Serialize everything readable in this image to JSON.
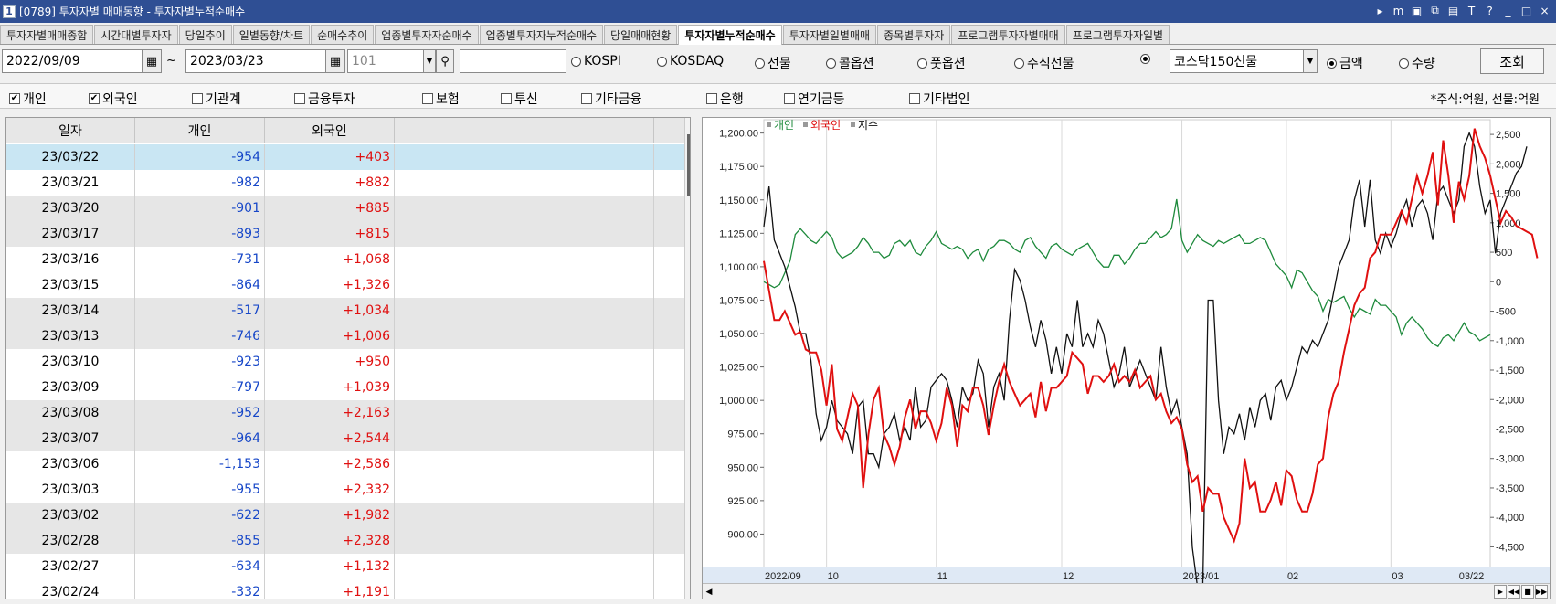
{
  "window": {
    "num": "1",
    "title": "[0789] 투자자별 매매동향 - 투자자별누적순매수",
    "buttons": [
      "▸",
      "m",
      "▣",
      "⧉",
      "▤",
      "T",
      "?",
      "_",
      "□",
      "×"
    ]
  },
  "tabs": [
    {
      "label": "투자자별매매종합",
      "active": false
    },
    {
      "label": "시간대별투자자",
      "active": false
    },
    {
      "label": "당일추이",
      "active": false
    },
    {
      "label": "일별동향/차트",
      "active": false
    },
    {
      "label": "순매수추이",
      "active": false
    },
    {
      "label": "업종별투자자순매수",
      "active": false
    },
    {
      "label": "업종별투자자누적순매수",
      "active": false
    },
    {
      "label": "당일매매현황",
      "active": false
    },
    {
      "label": "투자자별누적순매수",
      "active": true
    },
    {
      "label": "투자자별일별매매",
      "active": false
    },
    {
      "label": "종목별투자자",
      "active": false
    },
    {
      "label": "프로그램투자자별매매",
      "active": false
    },
    {
      "label": "프로그램투자자일별",
      "active": false
    }
  ],
  "toolbar": {
    "start_date": "2022/09/09",
    "tilde": "~",
    "end_date": "2023/03/23",
    "code": "101",
    "market_radios": [
      "KOSPI",
      "KOSDAQ",
      "선물",
      "콜옵션",
      "풋옵션",
      "주식선물"
    ],
    "selected_product": "코스닥150선물",
    "unit_radios": [
      {
        "label": "금액",
        "on": true
      },
      {
        "label": "수량",
        "on": false
      }
    ],
    "query_button": "조회"
  },
  "checks": [
    {
      "label": "개인",
      "checked": true
    },
    {
      "label": "외국인",
      "checked": true
    },
    {
      "label": "기관계",
      "checked": false
    },
    {
      "label": "금융투자",
      "checked": false
    },
    {
      "label": "보험",
      "checked": false
    },
    {
      "label": "투신",
      "checked": false
    },
    {
      "label": "기타금융",
      "checked": false
    },
    {
      "label": "은행",
      "checked": false
    },
    {
      "label": "연기금등",
      "checked": false
    },
    {
      "label": "기타법인",
      "checked": false
    }
  ],
  "units_note": "*주식:억원, 선물:억원",
  "table": {
    "headers": [
      "일자",
      "개인",
      "외국인",
      "",
      ""
    ],
    "rows": [
      [
        "23/03/22",
        "-954",
        "+403"
      ],
      [
        "23/03/21",
        "-982",
        "+882"
      ],
      [
        "23/03/20",
        "-901",
        "+885"
      ],
      [
        "23/03/17",
        "-893",
        "+815"
      ],
      [
        "23/03/16",
        "-731",
        "+1,068"
      ],
      [
        "23/03/15",
        "-864",
        "+1,326"
      ],
      [
        "23/03/14",
        "-517",
        "+1,034"
      ],
      [
        "23/03/13",
        "-746",
        "+1,006"
      ],
      [
        "23/03/10",
        "-923",
        "+950"
      ],
      [
        "23/03/09",
        "-797",
        "+1,039"
      ],
      [
        "23/03/08",
        "-952",
        "+2,163"
      ],
      [
        "23/03/07",
        "-964",
        "+2,544"
      ],
      [
        "23/03/06",
        "-1,153",
        "+2,586"
      ],
      [
        "23/03/03",
        "-955",
        "+2,332"
      ],
      [
        "23/03/02",
        "-622",
        "+1,982"
      ],
      [
        "23/02/28",
        "-855",
        "+2,328"
      ],
      [
        "23/02/27",
        "-634",
        "+1,132"
      ],
      [
        "23/02/24",
        "-332",
        "+1,191"
      ]
    ]
  },
  "chart_data": {
    "type": "line",
    "legend": [
      {
        "name": "개인",
        "color": "#1e8a3c"
      },
      {
        "name": "외국인",
        "color": "#e01010"
      },
      {
        "name": "지수",
        "color": "#111111"
      }
    ],
    "x_tick_labels": [
      "2022/09",
      "10",
      "11",
      "12",
      "2023/01",
      "02",
      "03",
      "03/22"
    ],
    "x_tick_index": [
      0,
      12,
      33,
      57,
      80,
      100,
      120,
      138
    ],
    "left_axis": {
      "ticks": [
        "1,200.00",
        "1,175.00",
        "1,150.00",
        "1,125.00",
        "1,100.00",
        "1,075.00",
        "1,050.00",
        "1,025.00",
        "1,000.00",
        "975.00",
        "950.00",
        "925.00",
        "900.00"
      ],
      "range": [
        875,
        1210
      ]
    },
    "right_axis": {
      "ticks": [
        "2,500",
        "2,000",
        "1,500",
        "1,000",
        "500",
        "0",
        "-500",
        "-1,000",
        "-1,500",
        "-2,000",
        "-2,500",
        "-3,000",
        "-3,500",
        "-4,000",
        "-4,500"
      ],
      "range": [
        -4850,
        2750
      ]
    },
    "series": [
      {
        "name": "개인",
        "axis": "right",
        "values": [
          0,
          -50,
          -100,
          -50,
          150,
          350,
          800,
          900,
          800,
          700,
          650,
          750,
          850,
          750,
          500,
          400,
          450,
          500,
          600,
          750,
          650,
          500,
          500,
          400,
          450,
          650,
          700,
          600,
          700,
          500,
          450,
          600,
          700,
          850,
          650,
          600,
          550,
          600,
          550,
          400,
          500,
          550,
          350,
          550,
          600,
          700,
          700,
          650,
          550,
          500,
          700,
          750,
          600,
          500,
          400,
          600,
          650,
          550,
          500,
          450,
          550,
          600,
          650,
          500,
          350,
          250,
          250,
          450,
          450,
          300,
          400,
          550,
          650,
          650,
          750,
          850,
          750,
          800,
          900,
          1400,
          700,
          500,
          650,
          800,
          700,
          650,
          600,
          700,
          650,
          700,
          750,
          800,
          650,
          650,
          700,
          750,
          700,
          500,
          300,
          200,
          100,
          -100,
          200,
          150,
          0,
          -150,
          -250,
          -500,
          -300,
          -350,
          -300,
          -250,
          -450,
          -600,
          -450,
          -500,
          -550,
          -300,
          -400,
          -400,
          -500,
          -600,
          -900,
          -700,
          -600,
          -700,
          -800,
          -950,
          -1050,
          -1100,
          -950,
          -900,
          -1000,
          -850,
          -700,
          -850,
          -900,
          -1000,
          -950,
          -900
        ]
      },
      {
        "name": "외국인",
        "axis": "right",
        "values": [
          350,
          -150,
          -650,
          -650,
          -500,
          -700,
          -900,
          -850,
          -1150,
          -1200,
          -1200,
          -1500,
          -2100,
          -1400,
          -2500,
          -2700,
          -2300,
          -1900,
          -2100,
          -3500,
          -2600,
          -2000,
          -1800,
          -2600,
          -2800,
          -3100,
          -2800,
          -2300,
          -2000,
          -2500,
          -2200,
          -2200,
          -2400,
          -2700,
          -2400,
          -1800,
          -2100,
          -2800,
          -2100,
          -2200,
          -1800,
          -1800,
          -2100,
          -2600,
          -2100,
          -1700,
          -1400,
          -1700,
          -1900,
          -2100,
          -2000,
          -1900,
          -2300,
          -1700,
          -2200,
          -1800,
          -1800,
          -1700,
          -1600,
          -1200,
          -1300,
          -1400,
          -1900,
          -1600,
          -1600,
          -1700,
          -1600,
          -1400,
          -1700,
          -1600,
          -1700,
          -1500,
          -1800,
          -1700,
          -1600,
          -2000,
          -1900,
          -2200,
          -2400,
          -2300,
          -2500,
          -3100,
          -3400,
          -3300,
          -3900,
          -3500,
          -3600,
          -3600,
          -4000,
          -4200,
          -4400,
          -4100,
          -3000,
          -3500,
          -3400,
          -3900,
          -3900,
          -3700,
          -3400,
          -3800,
          -3200,
          -3300,
          -3700,
          -3900,
          -3900,
          -3600,
          -3100,
          -3000,
          -2300,
          -1900,
          -1700,
          -1200,
          -800,
          -400,
          -200,
          -100,
          400,
          500,
          800,
          800,
          800,
          1000,
          1200,
          1000,
          1400,
          1800,
          1500,
          1800,
          2200,
          1300,
          2400,
          1800,
          1000,
          1700,
          1400,
          1800,
          2600,
          2300,
          2100,
          1800,
          1400,
          1000,
          1200,
          1100,
          950,
          900,
          850,
          800,
          400
        ]
      },
      {
        "name": "지수",
        "axis": "left",
        "values": [
          1130,
          1160,
          1120,
          1110,
          1100,
          1085,
          1070,
          1050,
          1050,
          1030,
          990,
          970,
          980,
          1000,
          985,
          980,
          975,
          960,
          995,
          1000,
          960,
          960,
          950,
          975,
          980,
          990,
          970,
          980,
          970,
          1010,
          980,
          985,
          1010,
          1015,
          1020,
          1015,
          1000,
          980,
          1010,
          1000,
          1005,
          1030,
          1020,
          980,
          1010,
          1020,
          1000,
          1060,
          1098,
          1090,
          1075,
          1055,
          1040,
          1060,
          1045,
          1020,
          1040,
          1020,
          1050,
          1040,
          1075,
          1040,
          1050,
          1040,
          1060,
          1050,
          1030,
          1010,
          1020,
          1040,
          1010,
          1020,
          1030,
          1020,
          1010,
          1000,
          1040,
          1010,
          990,
          1000,
          980,
          960,
          890,
          860,
          860,
          1075,
          1075,
          1000,
          960,
          980,
          975,
          990,
          970,
          995,
          980,
          1000,
          1005,
          985,
          1010,
          1015,
          1000,
          1010,
          1025,
          1040,
          1035,
          1045,
          1040,
          1050,
          1060,
          1080,
          1100,
          1110,
          1120,
          1150,
          1165,
          1130,
          1165,
          1120,
          1110,
          1125,
          1115,
          1125,
          1140,
          1150,
          1130,
          1145,
          1150,
          1140,
          1120,
          1155,
          1160,
          1150,
          1140,
          1150,
          1190,
          1200,
          1190,
          1160,
          1140,
          1150,
          1110,
          1140,
          1150,
          1160,
          1170,
          1175,
          1190
        ]
      }
    ]
  }
}
